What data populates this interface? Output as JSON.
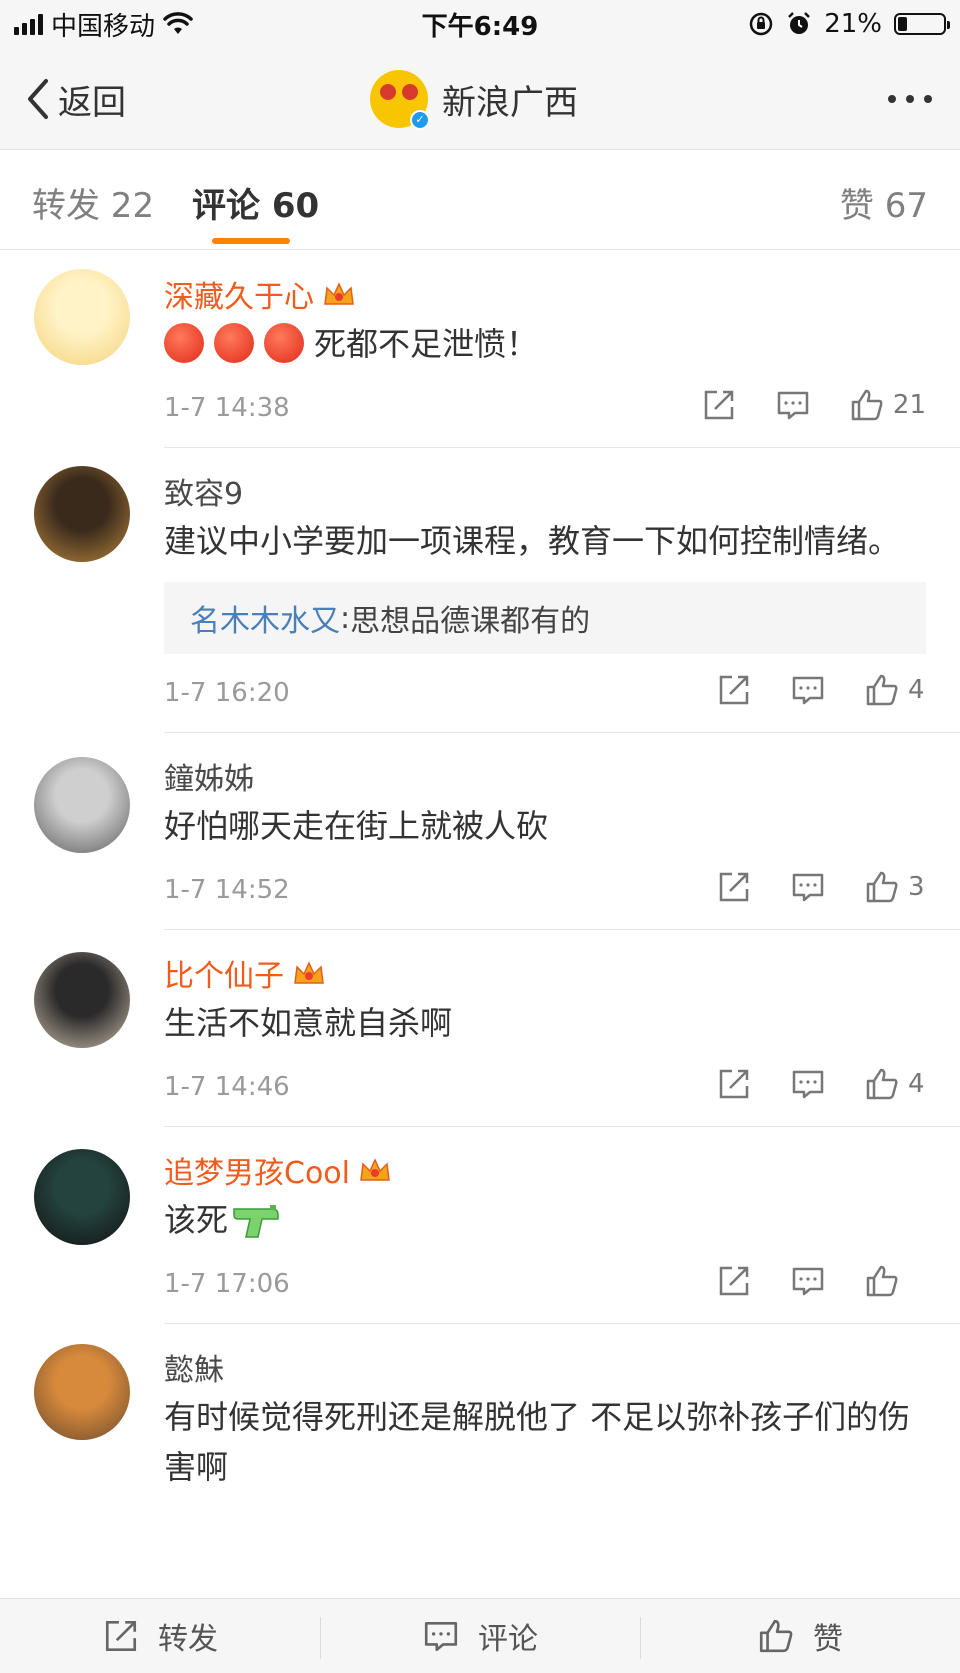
{
  "status_bar": {
    "carrier": "中国移动",
    "time": "下午6:49",
    "battery_text": "21%",
    "battery_level": 0.21
  },
  "nav": {
    "back_label": "返回",
    "title": "新浪广西"
  },
  "tabs": {
    "repost": "转发 22",
    "comments": "评论 60",
    "likes": "赞 67"
  },
  "comments": [
    {
      "user": "深藏久于心",
      "vip": true,
      "emoji_count": 3,
      "text": "死都不足泄愤！",
      "time": "1-7 14:38",
      "likes": "21",
      "avatar_colors": [
        "#fff3c7",
        "#f4d27a"
      ]
    },
    {
      "user": "致容9",
      "vip": false,
      "text": "建议中小学要加一项课程，教育一下如何控制情绪。",
      "reply_user": "名木木水又",
      "reply_sep": ": ",
      "reply_text": "思想品德课都有的",
      "time": "1-7 16:20",
      "likes": "4",
      "avatar_colors": [
        "#3a2a1c",
        "#b8863d"
      ]
    },
    {
      "user": "鐘姊姊",
      "vip": false,
      "text": "好怕哪天走在街上就被人砍",
      "time": "1-7 14:52",
      "likes": "3",
      "avatar_colors": [
        "#cfcfcf",
        "#5c5c5c"
      ]
    },
    {
      "user": "比个仙子",
      "vip": true,
      "text": "生活不如意就自杀啊",
      "time": "1-7 14:46",
      "likes": "4",
      "avatar_colors": [
        "#2b2a2a",
        "#c9bca9"
      ]
    },
    {
      "user": "追梦男孩Cool",
      "vip": true,
      "text": "该死",
      "has_gun": true,
      "time": "1-7 17:06",
      "likes": "",
      "avatar_colors": [
        "#24433f",
        "#111111"
      ]
    },
    {
      "user": "懿鮇",
      "vip": false,
      "text": "有时候觉得死刑还是解脱他了 不足以弥补孩子们的伤害啊",
      "avatar_colors": [
        "#d88a3c",
        "#6a4a2c"
      ]
    }
  ],
  "bottom_bar": {
    "repost": "转发",
    "comment": "评论",
    "like": "赞"
  },
  "colors": {
    "vip_name": "#f25b1b",
    "reply_name": "#4b7fb8",
    "tab_indicator": "#ff8200"
  }
}
